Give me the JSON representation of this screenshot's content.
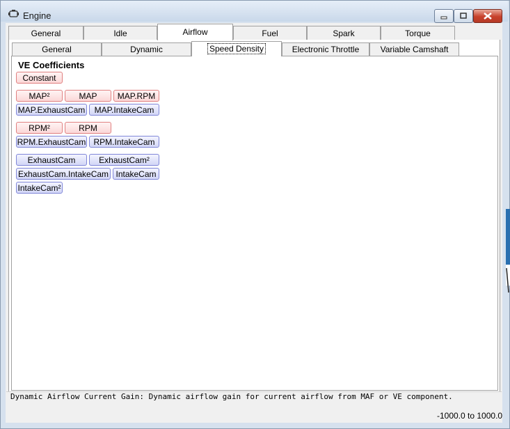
{
  "window": {
    "title": "Engine",
    "icon": "engine-icon"
  },
  "caption_buttons": {
    "minimize": "minimize-icon",
    "maximize": "maximize-icon",
    "close": "close-icon"
  },
  "main_tabs": [
    {
      "label": "General"
    },
    {
      "label": "Idle"
    },
    {
      "label": "Airflow"
    },
    {
      "label": "Fuel"
    },
    {
      "label": "Spark"
    },
    {
      "label": "Torque Management"
    }
  ],
  "main_tabs_selected": "Airflow",
  "sub_tabs": [
    {
      "label": "General"
    },
    {
      "label": "Dynamic"
    },
    {
      "label": "Speed Density"
    },
    {
      "label": "Electronic Throttle"
    },
    {
      "label": "Variable Camshaft"
    }
  ],
  "sub_tabs_selected": "Speed Density",
  "ve": {
    "title": "VE Coefficients",
    "constant": "Constant",
    "map_sq": "MAP²",
    "map": "MAP",
    "map_rpm": "MAP.RPM",
    "map_exhaust": "MAP.ExhaustCam",
    "map_intake": "MAP.IntakeCam",
    "rpm_sq": "RPM²",
    "rpm": "RPM",
    "rpm_exhaust": "RPM.ExhaustCam",
    "rpm_intake": "RPM.IntakeCam",
    "exhaust": "ExhaustCam",
    "exhaust_sq": "ExhaustCam²",
    "exhaust_intake": "ExhaustCam.IntakeCam",
    "intake": "IntakeCam",
    "intake_sq": "IntakeCam²"
  },
  "status": {
    "description": "Dynamic Airflow Current Gain: Dynamic airflow gain for current airflow from MAF or VE component.",
    "range": "-1000.0 to 1000.0"
  },
  "colors": {
    "red_btn_border": "#e08080",
    "blue_btn_border": "#7f86d8",
    "close_btn": "#c7412b"
  }
}
